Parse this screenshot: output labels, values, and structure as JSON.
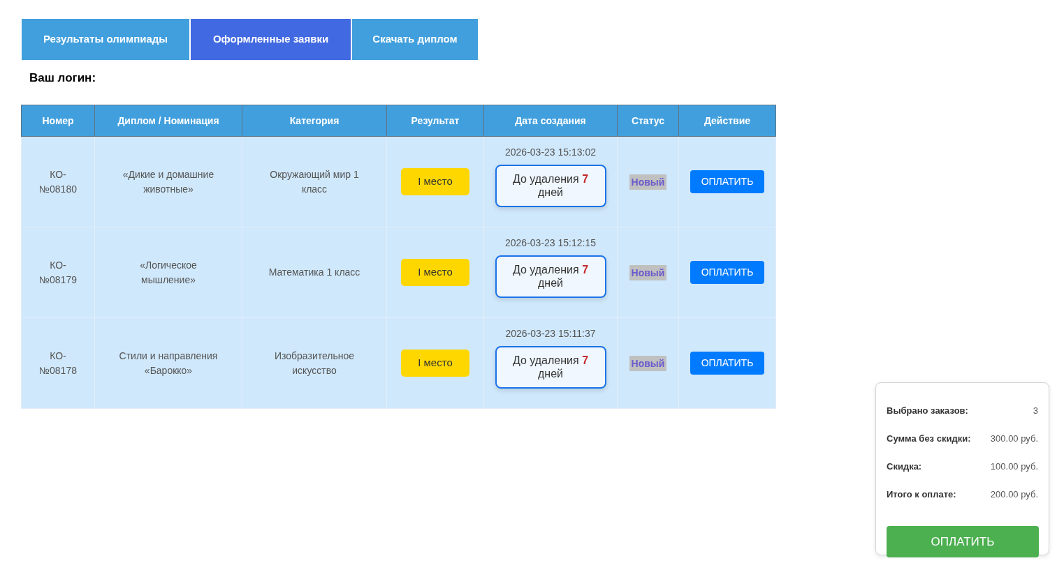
{
  "tabs": [
    {
      "label": "Результаты олимпиады",
      "selected": false
    },
    {
      "label": "Оформленные заявки",
      "selected": true
    },
    {
      "label": "Скачать диплом",
      "selected": false
    }
  ],
  "login_label": "Ваш логин:",
  "table": {
    "columns": [
      "Номер",
      "Диплом / Номинация",
      "Категория",
      "Результат",
      "Дата создания",
      "Статус",
      "Действие"
    ],
    "rows": [
      {
        "number": "КО-№08180",
        "diploma": "«Дикие и домашние животные»",
        "category": "Окружающий мир 1 класс",
        "result": "I место",
        "created": "2026-03-23 15:13:02",
        "deletion": {
          "label": "До удаления",
          "days": "7",
          "unit": "дней"
        },
        "status": "Новый",
        "action": "ОПЛАТИТЬ"
      },
      {
        "number": "КО-№08179",
        "diploma": "«Логическое мышление»",
        "category": "Математика 1 класс",
        "result": "I место",
        "created": "2026-03-23 15:12:15",
        "deletion": {
          "label": "До удаления",
          "days": "7",
          "unit": "дней"
        },
        "status": "Новый",
        "action": "ОПЛАТИТЬ"
      },
      {
        "number": "КО-№08178",
        "diploma": "Стили и направления «Барокко»",
        "category": "Изобразительное искусство",
        "result": "I место",
        "created": "2026-03-23 15:11:37",
        "deletion": {
          "label": "До удаления",
          "days": "7",
          "unit": "дней"
        },
        "status": "Новый",
        "action": "ОПЛАТИТЬ"
      }
    ]
  },
  "summary": {
    "items": [
      {
        "label": "Выбрано заказов:",
        "value": "3"
      },
      {
        "label": "Сумма без скидки:",
        "value": "300.00 руб."
      },
      {
        "label": "Скидка:",
        "value": "100.00 руб."
      },
      {
        "label": "Итого к оплате:",
        "value": "200.00 руб."
      }
    ],
    "button": "ОПЛАТИТЬ"
  }
}
